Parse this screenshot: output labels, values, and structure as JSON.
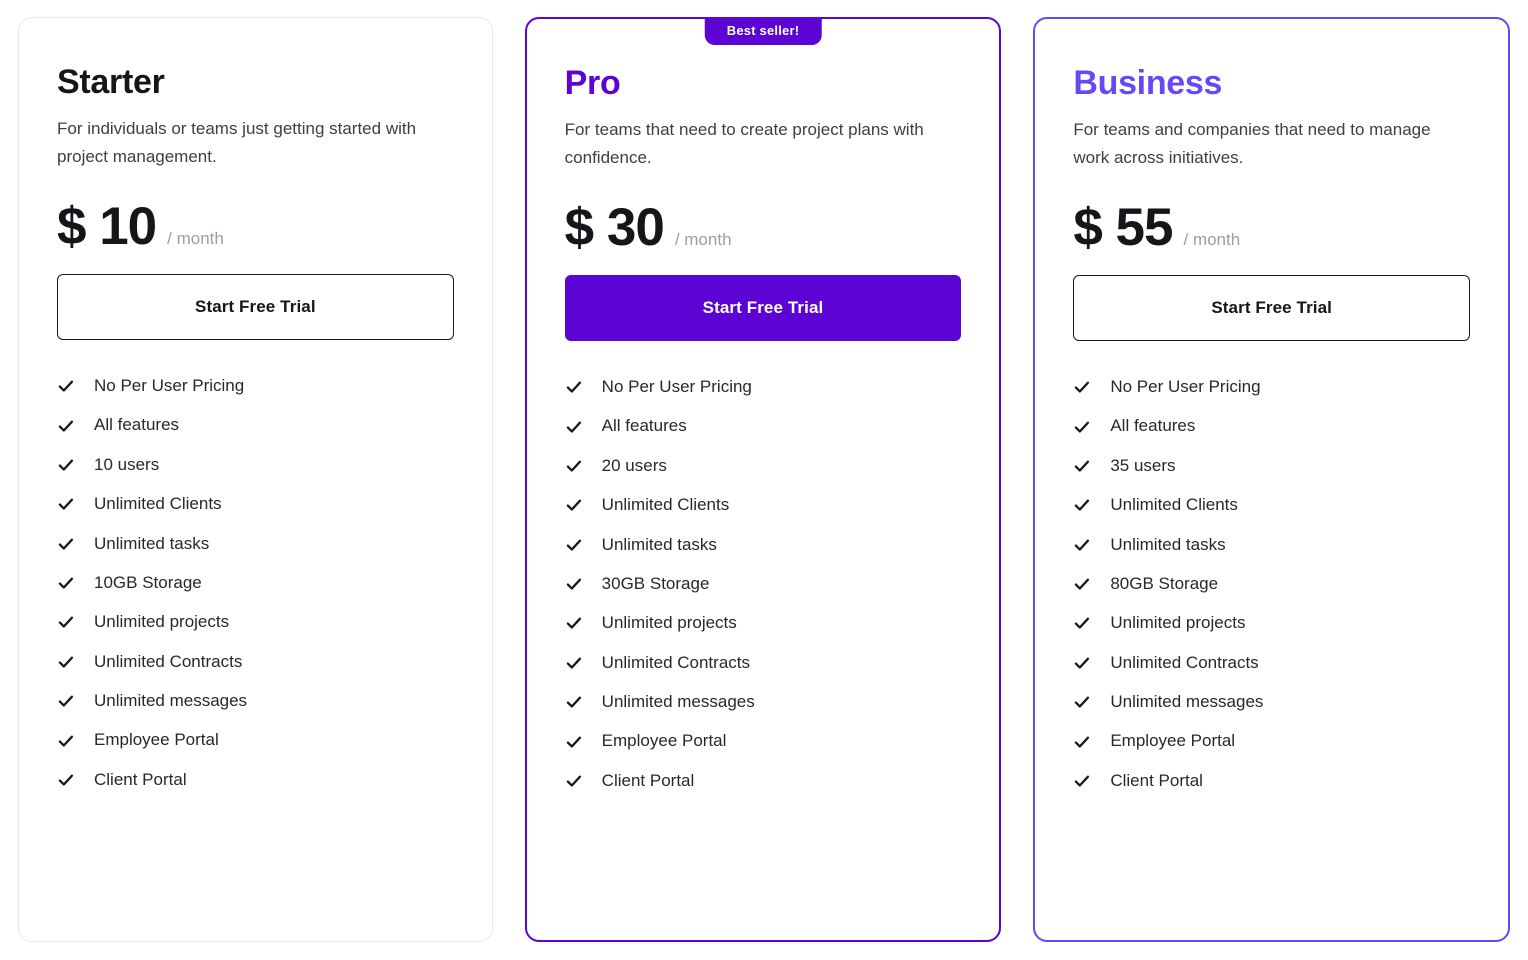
{
  "plans": [
    {
      "name": "Starter",
      "name_tone": "tone-dark",
      "card_variant": "variant-plain",
      "tagline": "For individuals or teams just getting started with project management.",
      "price": "$ 10",
      "period": "/ month",
      "cta_label": "Start Free Trial",
      "cta_style": "style-outline",
      "badge": null,
      "features": [
        "No Per User Pricing",
        "All features",
        "10 users",
        "Unlimited Clients",
        "Unlimited tasks",
        "10GB Storage",
        "Unlimited projects",
        "Unlimited Contracts",
        "Unlimited messages",
        "Employee Portal",
        "Client Portal"
      ]
    },
    {
      "name": "Pro",
      "name_tone": "tone-deep",
      "card_variant": "variant-featured",
      "tagline": "For teams that need to create project plans with confidence.",
      "price": "$ 30",
      "period": "/ month",
      "cta_label": "Start Free Trial",
      "cta_style": "style-solid",
      "badge": "Best seller!",
      "features": [
        "No Per User Pricing",
        "All features",
        "20 users",
        "Unlimited Clients",
        "Unlimited tasks",
        "30GB Storage",
        "Unlimited projects",
        "Unlimited Contracts",
        "Unlimited messages",
        "Employee Portal",
        "Client Portal"
      ]
    },
    {
      "name": "Business",
      "name_tone": "tone-violet",
      "card_variant": "variant-outlined",
      "tagline": "For teams and companies that need to manage work across initiatives.",
      "price": "$ 55",
      "period": "/ month",
      "cta_label": "Start Free Trial",
      "cta_style": "style-outline",
      "badge": null,
      "features": [
        "No Per User Pricing",
        "All features",
        "35 users",
        "Unlimited Clients",
        "Unlimited tasks",
        "80GB Storage",
        "Unlimited projects",
        "Unlimited Contracts",
        "Unlimited messages",
        "Employee Portal",
        "Client Portal"
      ]
    }
  ],
  "colors": {
    "brand_deep_purple": "#5B04D4",
    "brand_violet": "#6649F5",
    "text_dark": "#14161A",
    "text_muted": "#9AA0A6",
    "card_border_light": "#E8E8E8"
  },
  "icons": {
    "check": "check-icon"
  }
}
